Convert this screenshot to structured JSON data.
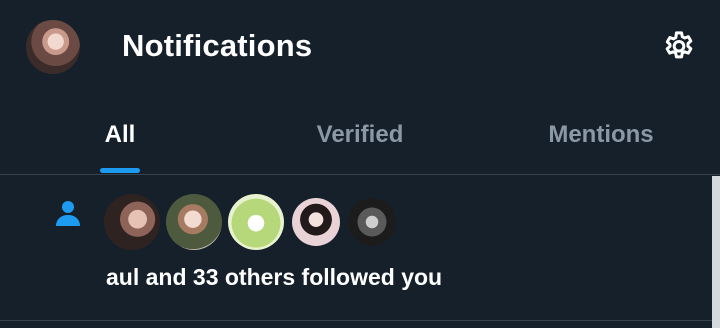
{
  "header": {
    "title": "Notifications",
    "avatar_icon": "profile-avatar",
    "settings_icon": "gear-icon"
  },
  "tabs": [
    {
      "label": "All",
      "active": true
    },
    {
      "label": "Verified",
      "active": false
    },
    {
      "label": "Mentions",
      "active": false
    }
  ],
  "notifications": [
    {
      "icon": "person-icon",
      "text": "aul and 33 others followed you",
      "avatars": [
        "follower-avatar-1",
        "follower-avatar-2",
        "follower-avatar-3",
        "follower-avatar-4",
        "follower-avatar-5"
      ]
    }
  ],
  "colors": {
    "background": "#15202b",
    "accent": "#1d9bf0",
    "divider": "#38444d",
    "muted_text": "#8b98a5"
  }
}
